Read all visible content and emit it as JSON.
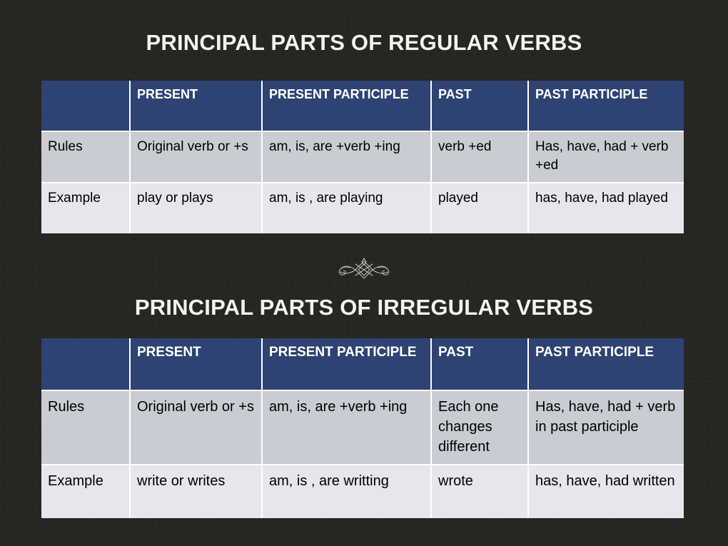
{
  "slide": {
    "background_color": "#262622",
    "header_color": "#2e4373",
    "row_rules_color": "#c9ccd2",
    "row_example_color": "#e6e6ec",
    "title_color": "#f2f2f0"
  },
  "ornament": {
    "name": "decorative-flourish",
    "color": "#b9bcb6"
  },
  "sections": [
    {
      "id": "regular",
      "title": "PRINCIPAL PARTS OF REGULAR VERBS",
      "table": {
        "headers": [
          "",
          "PRESENT",
          "PRESENT PARTICIPLE",
          "PAST",
          "PAST PARTICIPLE"
        ],
        "rows": [
          {
            "label": "Rules",
            "present": "Original verb or +s",
            "present_participle": "am, is, are +verb +ing",
            "past": "verb +ed",
            "past_participle": "Has, have, had + verb +ed"
          },
          {
            "label": "Example",
            "present": "play or plays",
            "present_participle": "am, is , are playing",
            "past": "played",
            "past_participle": "has, have, had played"
          }
        ]
      }
    },
    {
      "id": "irregular",
      "title": "PRINCIPAL PARTS OF IRREGULAR VERBS",
      "table": {
        "headers": [
          "",
          "PRESENT",
          "PRESENT PARTICIPLE",
          "PAST",
          "PAST PARTICIPLE"
        ],
        "rows": [
          {
            "label": "Rules",
            "present": "Original verb or +s",
            "present_participle": "am, is, are +verb +ing",
            "past": "Each one changes different",
            "past_participle": "Has, have, had + verb in past participle"
          },
          {
            "label": "Example",
            "present": "write or writes",
            "present_participle": "am, is , are writting",
            "past": "wrote",
            "past_participle": "has, have, had written"
          }
        ]
      }
    }
  ]
}
